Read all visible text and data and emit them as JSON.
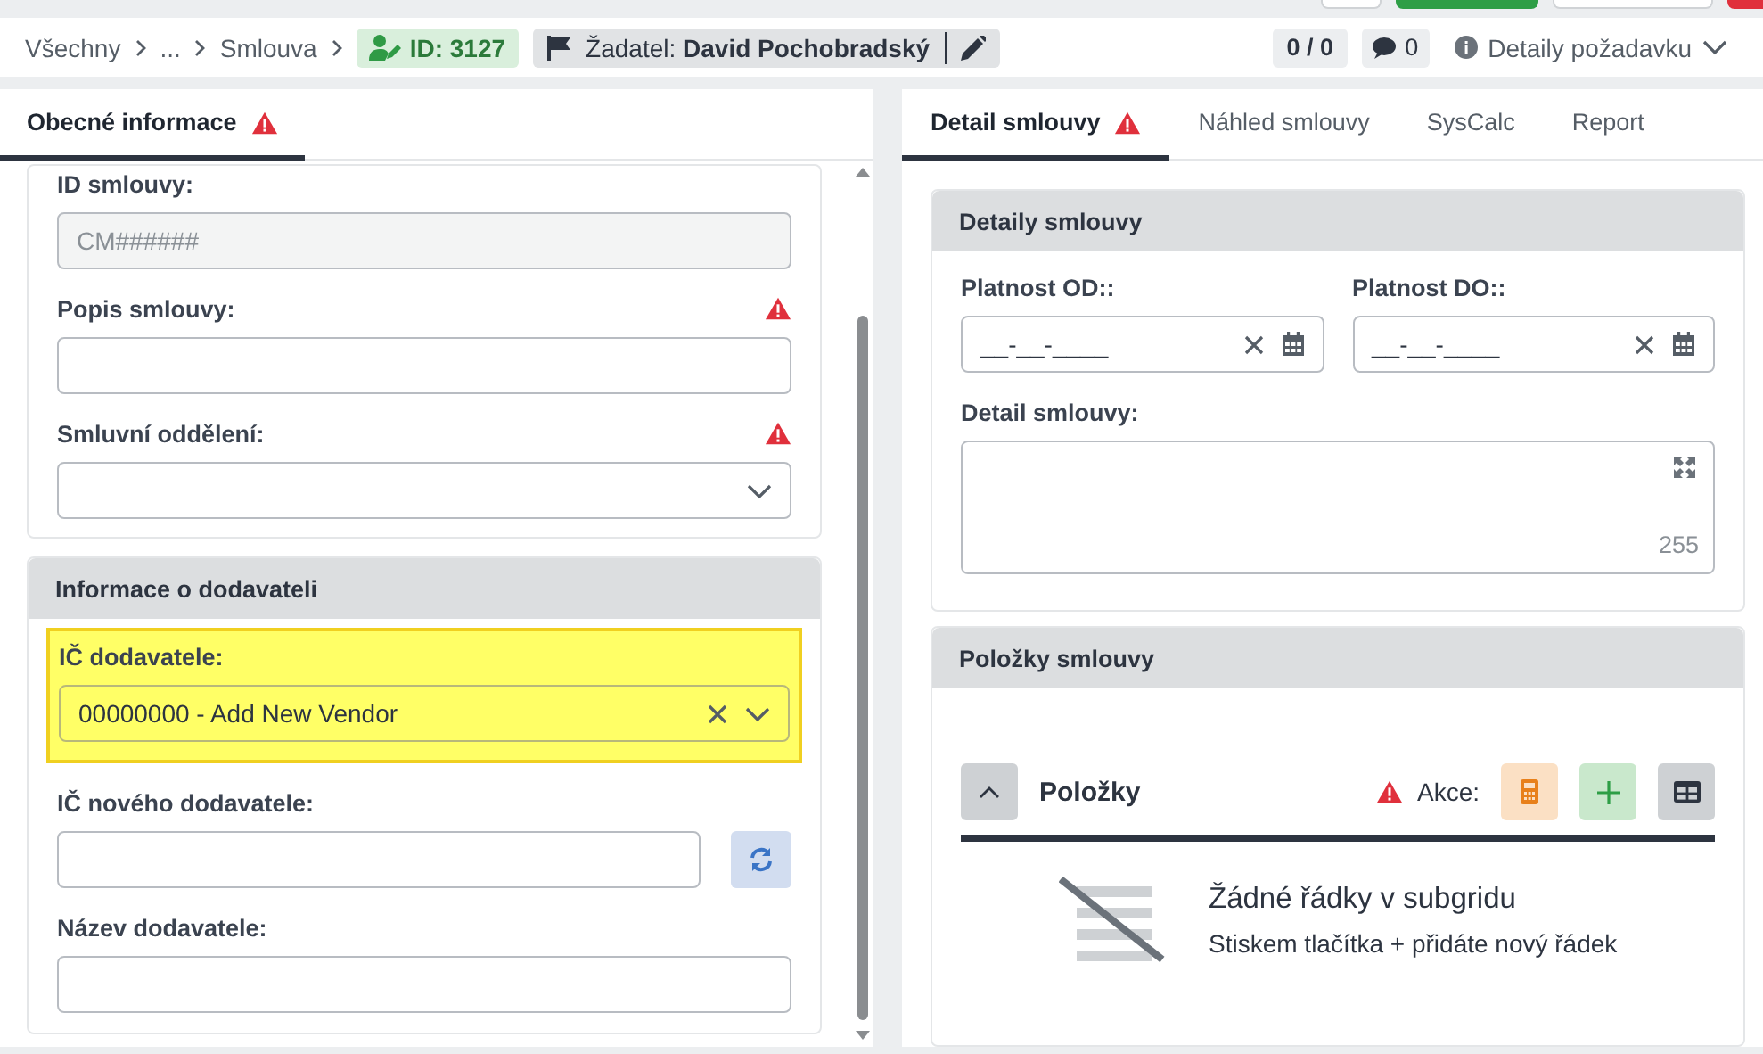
{
  "breadcrumbs": [
    {
      "label": "Všechny"
    },
    {
      "label": "..."
    },
    {
      "label": "Smlouva"
    }
  ],
  "id_badge": "ID: 3127",
  "requester": {
    "label": "Žadatel:",
    "name": "David Pochobradský"
  },
  "counter": "0 / 0",
  "comments": "0",
  "details_toggle": "Detaily požadavku",
  "left_tabs": [
    {
      "label": "Obecné informace",
      "selected": true,
      "warning": true
    }
  ],
  "general_fields": [
    {
      "label": "ID smlouvy:",
      "kind": "text",
      "placeholder": "CM######",
      "disabled": true,
      "required": false
    },
    {
      "label": "Popis smlouvy:",
      "kind": "text",
      "disabled": false,
      "required": true
    },
    {
      "label": "Smluvní oddělení:",
      "kind": "select",
      "disabled": false,
      "required": true
    }
  ],
  "vendor_section": {
    "title": "Informace o dodavateli",
    "fields": [
      {
        "label": "IČ dodavatele:",
        "kind": "select",
        "value": "00000000 - Add New Vendor",
        "highlighted": true,
        "clearable": true
      },
      {
        "label": "IČ nového dodavatele:",
        "kind": "refresh",
        "highlighted": false,
        "clearable": false
      },
      {
        "label": "Název dodavatele:",
        "kind": "text",
        "highlighted": false,
        "clearable": false
      }
    ]
  },
  "right_tabs": [
    {
      "label": "Detail smlouvy",
      "selected": true,
      "warning": true
    },
    {
      "label": "Náhled smlouvy",
      "selected": false,
      "warning": false
    },
    {
      "label": "SysCalc",
      "selected": false,
      "warning": false
    },
    {
      "label": "Report",
      "selected": false,
      "warning": false
    }
  ],
  "details_section": {
    "title": "Detaily smlouvy",
    "dates": [
      {
        "label": "Platnost OD::",
        "placeholder": "__-__-____"
      },
      {
        "label": "Platnost DO::",
        "placeholder": "__-__-____"
      }
    ],
    "detail": {
      "label": "Detail smlouvy:",
      "counter": "255"
    }
  },
  "items_section": {
    "title": "Položky smlouvy",
    "subgrid": {
      "title": "Položky",
      "expanded": true,
      "warning": true,
      "actions_label": "Akce:",
      "empty_title": "Žádné řádky v subgridu",
      "empty_hint": "Stiskem tlačítka + přidáte nový řádek"
    }
  }
}
